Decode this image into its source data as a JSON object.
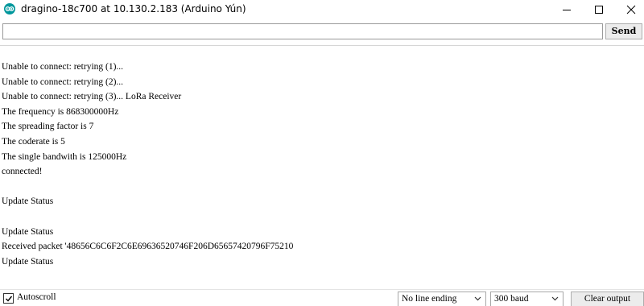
{
  "window": {
    "title": "dragino-18c700 at 10.130.2.183 (Arduino Yún)",
    "icon": "arduino-icon",
    "controls": [
      "minimize-icon",
      "maximize-icon",
      "close-icon"
    ]
  },
  "send_bar": {
    "input_value": "",
    "send_label": "Send"
  },
  "console": {
    "lines": [
      "Unable to connect: retrying (1)...",
      "Unable to connect: retrying (2)...",
      "Unable to connect: retrying (3)... LoRa Receiver",
      "The frequency is 868300000Hz",
      "The spreading factor is 7",
      "The coderate is 5",
      "The single bandwith is 125000Hz",
      "connected!",
      "",
      "Update Status",
      "",
      "Update Status",
      "Received packet '48656C6C6F2C6E69636520746F206D65657420796F75210",
      "Update Status"
    ]
  },
  "bottom_bar": {
    "autoscroll_label": "Autoscroll",
    "autoscroll_checked": true,
    "line_ending_value": "No line ending",
    "baud_value": "300 baud",
    "clear_label": "Clear output"
  },
  "colors": {
    "accent": "#00979c",
    "border": "#9a9a9a",
    "button_bg": "#ececec"
  }
}
